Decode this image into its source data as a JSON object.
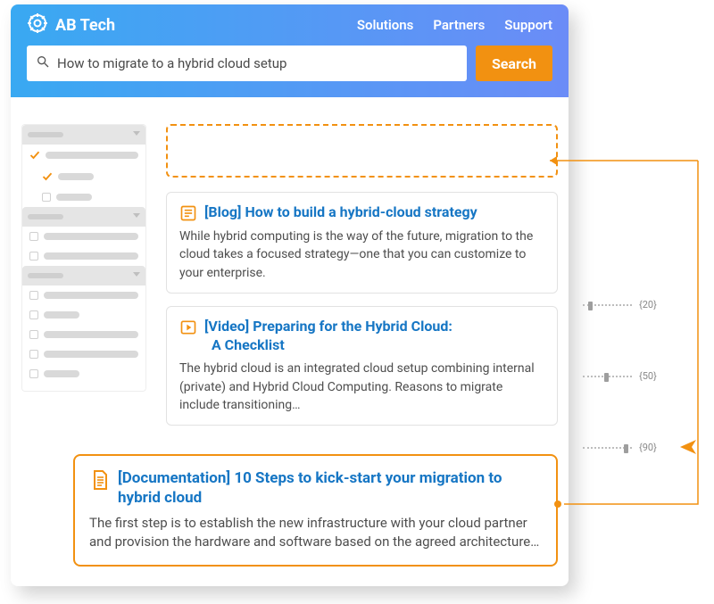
{
  "brand": "AB Tech",
  "nav": {
    "solutions": "Solutions",
    "partners": "Partners",
    "support": "Support"
  },
  "search": {
    "value": "How to migrate to a hybrid cloud setup",
    "button": "Search"
  },
  "results": {
    "blog": {
      "title": "[Blog] How to build a hybrid-cloud strategy",
      "body": "While hybrid computing is the way of the future, migration to the cloud takes a focused strategy—one that you can customize to your enterprise."
    },
    "video": {
      "title_l1": "[Video] Preparing for the Hybrid Cloud:",
      "title_l2": "A Checklist",
      "body": "The hybrid cloud is an integrated cloud setup combining internal (private) and Hybrid Cloud Computing. Reasons to migrate include transitioning…"
    },
    "doc": {
      "title": "[Documentation] 10 Steps to kick-start your migration to hybrid cloud",
      "body": "The first step is to establish the new infrastructure with your cloud partner and provision the hardware and software based on the agreed architecture…"
    }
  },
  "sliders": {
    "s1": "{20}",
    "s2": "{50}",
    "s3": "{90}"
  }
}
